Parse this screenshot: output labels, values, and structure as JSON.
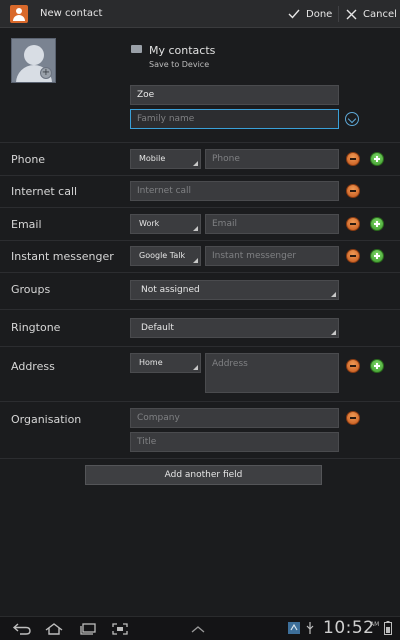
{
  "action_bar": {
    "title": "New contact",
    "done_label": "Done",
    "cancel_label": "Cancel"
  },
  "account": {
    "name": "My contacts",
    "sub": "Save to Device"
  },
  "name": {
    "given_value": "Zoe",
    "family_placeholder": "Family name"
  },
  "phone": {
    "label": "Phone",
    "type": "Mobile",
    "placeholder": "Phone"
  },
  "internet_call": {
    "label": "Internet call",
    "placeholder": "Internet call"
  },
  "email": {
    "label": "Email",
    "type": "Work",
    "placeholder": "Email"
  },
  "im": {
    "label": "Instant messenger",
    "type": "Google Talk",
    "placeholder": "Instant messenger"
  },
  "groups": {
    "label": "Groups",
    "value": "Not assigned"
  },
  "ringtone": {
    "label": "Ringtone",
    "value": "Default"
  },
  "address": {
    "label": "Address",
    "type": "Home",
    "placeholder": "Address"
  },
  "organisation": {
    "label": "Organisation",
    "company_placeholder": "Company",
    "title_placeholder": "Title"
  },
  "add_field_label": "Add another field",
  "status": {
    "time": "10:52",
    "ampm": "AM"
  },
  "colors": {
    "accent": "#3aa0d8",
    "remove": "#d96a2a",
    "add": "#4cb53a",
    "brand": "#d9692b"
  }
}
